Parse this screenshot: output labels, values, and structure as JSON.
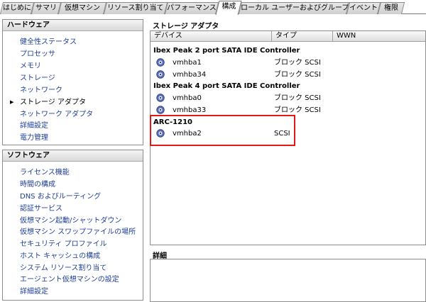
{
  "tabs": [
    {
      "label": "はじめに"
    },
    {
      "label": "サマリ"
    },
    {
      "label": "仮想マシン"
    },
    {
      "label": "リソース割り当て"
    },
    {
      "label": "パフォーマンス"
    },
    {
      "label": "構成"
    },
    {
      "label": "ローカル ユーザーおよびグループ"
    },
    {
      "label": "イベント"
    },
    {
      "label": "権限"
    }
  ],
  "active_tab": "構成",
  "hardware": {
    "title": "ハードウェア",
    "items": [
      {
        "label": "健全性ステータス"
      },
      {
        "label": "プロセッサ"
      },
      {
        "label": "メモリ"
      },
      {
        "label": "ストレージ"
      },
      {
        "label": "ネットワーク"
      },
      {
        "label": "ストレージ アダプタ"
      },
      {
        "label": "ネットワーク アダプタ"
      },
      {
        "label": "詳細設定"
      },
      {
        "label": "電力管理"
      }
    ],
    "current_item": "ストレージ アダプタ"
  },
  "software": {
    "title": "ソフトウェア",
    "items": [
      {
        "label": "ライセンス機能"
      },
      {
        "label": "時間の構成"
      },
      {
        "label": "DNS およびルーティング"
      },
      {
        "label": "認証サービス"
      },
      {
        "label": "仮想マシン起動/シャットダウン"
      },
      {
        "label": "仮想マシン スワップファイルの場所"
      },
      {
        "label": "セキュリティ プロファイル"
      },
      {
        "label": "ホスト キャッシュの構成"
      },
      {
        "label": "システム リソース割り当て"
      },
      {
        "label": "エージェント仮想マシンの設定"
      },
      {
        "label": "詳細設定"
      }
    ]
  },
  "main": {
    "title": "ストレージ アダプタ",
    "columns": [
      "デバイス",
      "タイプ",
      "WWN"
    ],
    "groups": [
      {
        "name": "Ibex Peak 2 port SATA IDE Controller",
        "adapters": [
          {
            "device": "vmhba1",
            "type": "ブロック SCSI"
          },
          {
            "device": "vmhba34",
            "type": "ブロック SCSI"
          }
        ]
      },
      {
        "name": "Ibex Peak 4 port SATA IDE Controller",
        "adapters": [
          {
            "device": "vmhba0",
            "type": "ブロック SCSI"
          },
          {
            "device": "vmhba33",
            "type": "ブロック SCSI"
          }
        ]
      },
      {
        "name": "ARC-1210",
        "adapters": [
          {
            "device": "vmhba2",
            "type": "SCSI"
          }
        ]
      }
    ],
    "highlight_color": "#e01a1a",
    "icon": "storage-adapter-icon"
  },
  "details": {
    "title": "詳細"
  },
  "colors": {
    "link": "#1d3f95",
    "highlight": "#e01a1a"
  }
}
